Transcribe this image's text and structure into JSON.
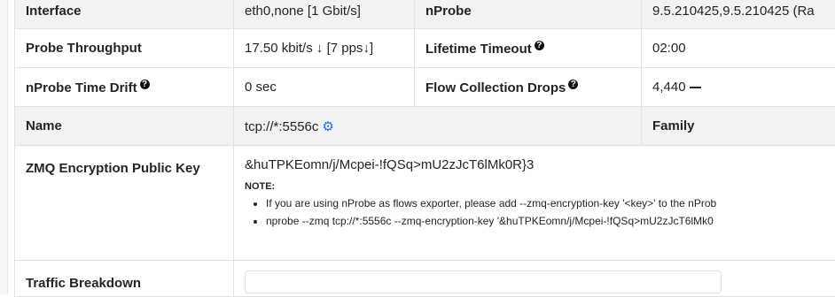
{
  "rows": [
    {
      "label": "Interface",
      "value": "eth0,none [1 Gbit/s]",
      "label2": "nProbe",
      "value2": "9.5.210425,9.5.210425 (Ra"
    },
    {
      "label": "Probe Throughput",
      "value_pre": "17.50 kbit/s",
      "value_mid": "[7 pps",
      "label2": "Lifetime Timeout",
      "value2": "02:00"
    },
    {
      "label": "nProbe Time Drift",
      "value": "0 sec",
      "label2": "Flow Collection Drops",
      "value2": "4,440"
    },
    {
      "label": "Name",
      "value": "tcp://*:5556c",
      "label3": "Family"
    }
  ],
  "zmq": {
    "label": "ZMQ Encryption Public Key",
    "key": "&huTPKEomn/j/Mcpei-!fQSq>mU2zJcT6lMk0R}3",
    "note_title": "NOTE:",
    "bullets": [
      "If you are using nProbe as flows exporter, please add --zmq-encryption-key '<key>' to the nProb",
      "nprobe --zmq tcp://*:5556c --zmq-encryption-key '&huTPKEomn/j/Mcpei-!fQSq>mU2zJcT6lMk0"
    ]
  },
  "bottom": {
    "label": "Traffic Breakdown"
  },
  "icons": {
    "help": "help-circle-icon",
    "gear": "gear-icon",
    "down": "arrow-down-icon",
    "dash": "dash-icon"
  },
  "colors": {
    "accent": "#1a73e8",
    "stripe": "#f2f2f2",
    "border": "#dee2e6"
  }
}
